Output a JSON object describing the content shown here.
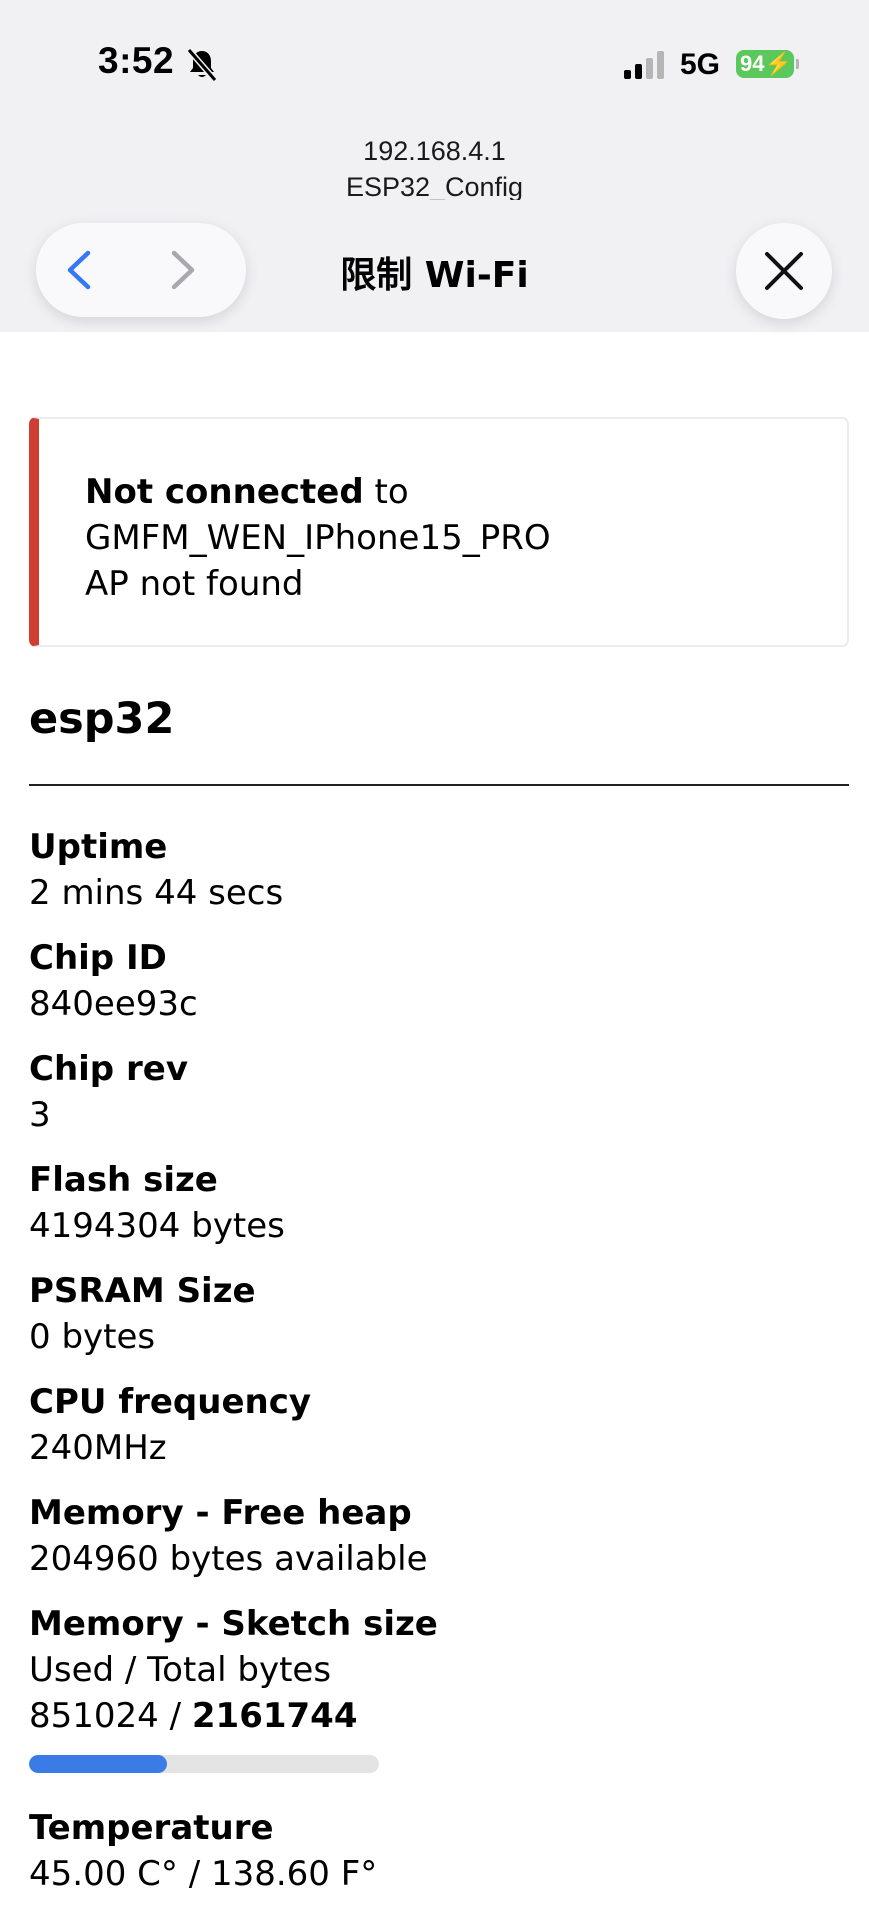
{
  "status_bar": {
    "time": "3:52",
    "network": "5G",
    "battery": "94"
  },
  "browser": {
    "host": "192.168.4.1",
    "page_title": "ESP32_Config",
    "sheet_title": "限制 Wi-Fi"
  },
  "alert": {
    "strong": "Not connected",
    "suffix": " to",
    "ssid": "GMFM_WEN_IPhone15_PRO",
    "reason": "AP not found",
    "accent_color": "#d03d33"
  },
  "device": {
    "name": "esp32"
  },
  "info": [
    {
      "label": "Uptime",
      "value": "2 mins 44 secs"
    },
    {
      "label": "Chip ID",
      "value": "840ee93c"
    },
    {
      "label": "Chip rev",
      "value": "3"
    },
    {
      "label": "Flash size",
      "value": "4194304 bytes"
    },
    {
      "label": "PSRAM Size",
      "value": "0 bytes"
    },
    {
      "label": "CPU frequency",
      "value": "240MHz"
    },
    {
      "label": "Memory - Free heap",
      "value": "204960 bytes available"
    }
  ],
  "sketch": {
    "label": "Memory - Sketch size",
    "subtitle": "Used / Total bytes",
    "used": "851024",
    "separator": " / ",
    "total": "2161744",
    "fraction": 0.394,
    "bar_color": "#3b7be5"
  },
  "temperature": {
    "label": "Temperature",
    "value": "45.00 C° / 138.60 F°"
  },
  "icons": {
    "mute": "bell-slash-icon",
    "signal": "cellular-signal-icon",
    "back": "chevron-left-icon",
    "forward": "chevron-right-icon",
    "close": "close-icon"
  }
}
